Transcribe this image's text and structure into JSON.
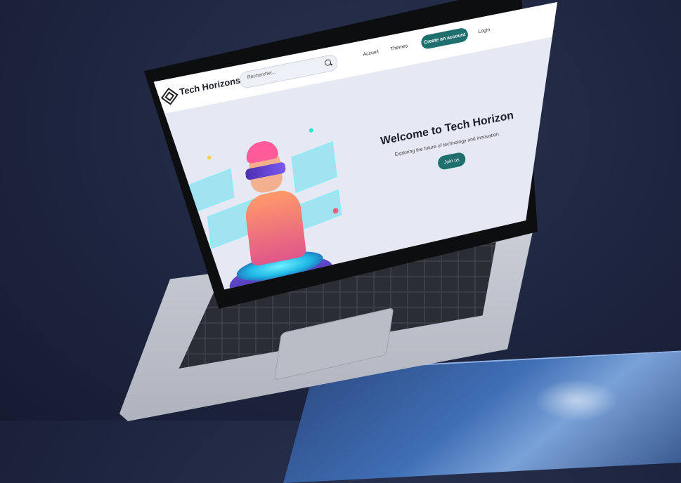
{
  "app": {
    "brand": "Tech Horizons"
  },
  "search": {
    "placeholder": "Rechercher..."
  },
  "nav": {
    "links": [
      "Accueil",
      "Themes"
    ],
    "create_account": "Create an account",
    "login": "Login"
  },
  "hero": {
    "title": "Welcome to Tech Horizon",
    "subtitle": "Exploring the future of technology and innovation.",
    "cta": "Join us"
  },
  "colors": {
    "accent": "#1f6f6e",
    "page_background": "#e6e9f4",
    "backdrop": "#1e2540",
    "platform": "#3f6fb5"
  },
  "icons": {
    "logo": "diamond-logo-icon",
    "search": "search-icon"
  }
}
